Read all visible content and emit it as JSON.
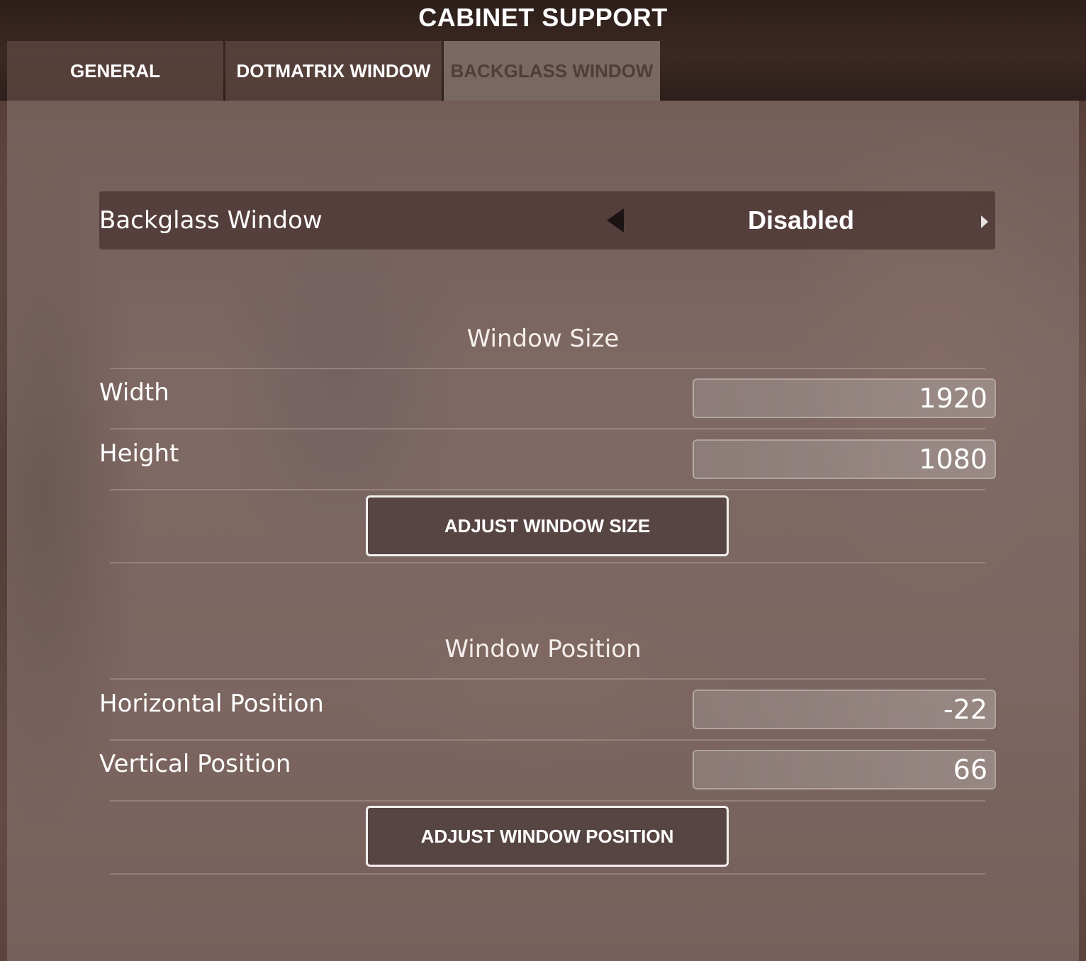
{
  "window": {
    "title": "CABINET SUPPORT"
  },
  "tabs": [
    {
      "label": "GENERAL",
      "active": false
    },
    {
      "label": "DOTMATRIX WINDOW",
      "active": false
    },
    {
      "label": "BACKGLASS WINDOW",
      "active": true
    }
  ],
  "backglass_setting": {
    "label": "Backglass Window",
    "value": "Disabled",
    "prev_icon": "left-arrow-icon",
    "next_icon": "right-arrow-icon"
  },
  "window_size": {
    "header": "Window Size",
    "width": {
      "label": "Width",
      "value": "1920"
    },
    "height": {
      "label": "Height",
      "value": "1080"
    },
    "button_label": "ADJUST WINDOW SIZE"
  },
  "window_position": {
    "header": "Window Position",
    "horizontal": {
      "label": "Horizontal Position",
      "value": "-22"
    },
    "vertical": {
      "label": "Vertical Position",
      "value": "66"
    },
    "button_label": "ADJUST WINDOW POSITION"
  },
  "colors": {
    "active_tab_text": "#4e3e3a",
    "button_border": "#f2efee",
    "text": "#ffffff"
  }
}
